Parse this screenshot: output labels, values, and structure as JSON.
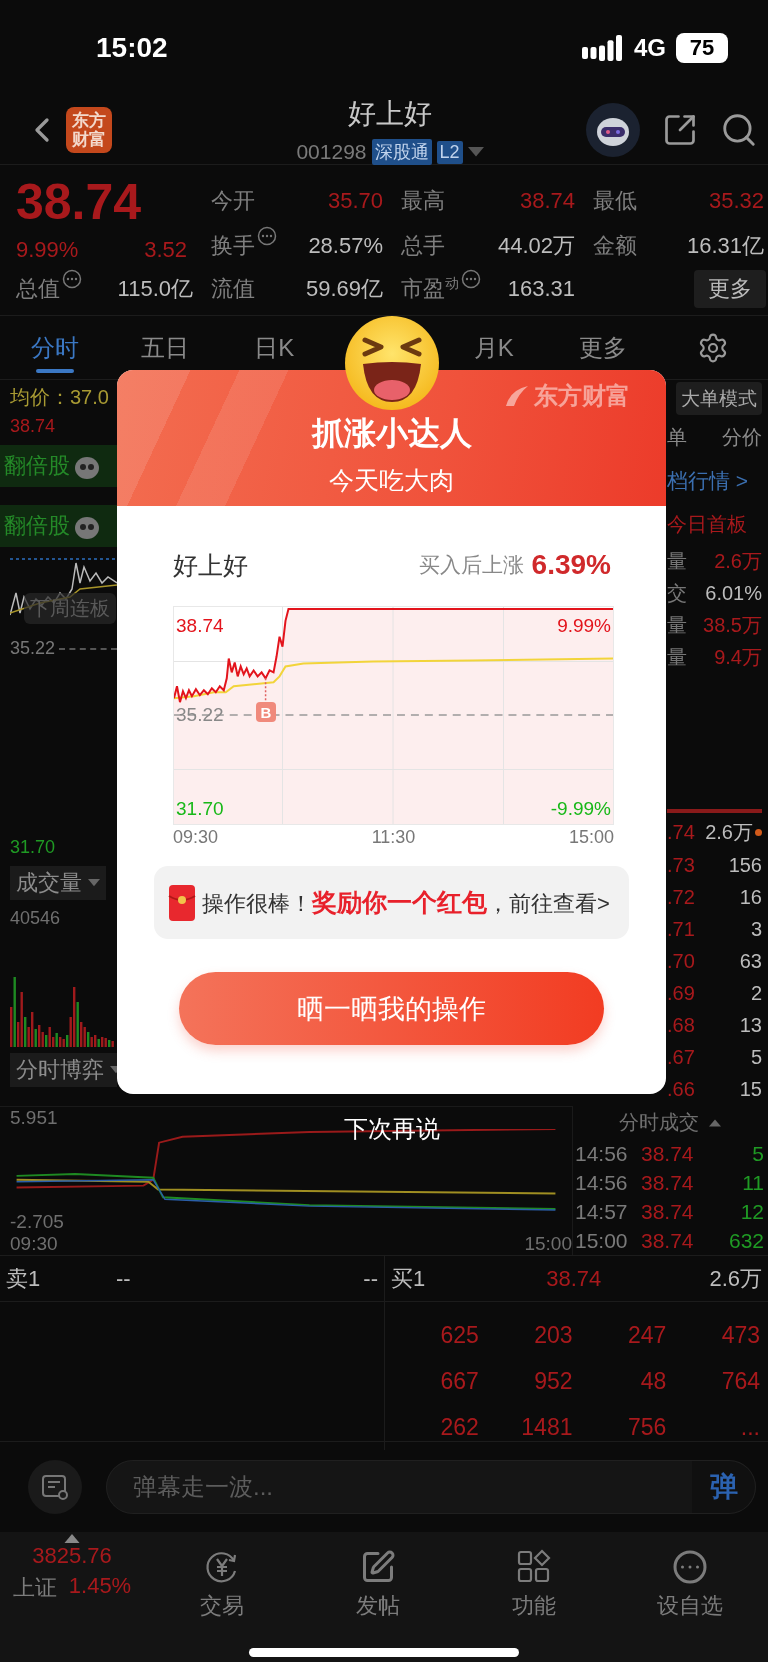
{
  "status_bar": {
    "time": "15:02",
    "network": "4G",
    "battery": "75"
  },
  "header": {
    "logo": [
      "东方",
      "财富"
    ],
    "title": "好上好",
    "code": "001298",
    "tags": [
      "深股通",
      "L2"
    ]
  },
  "quote": {
    "price": "38.74",
    "change_pct": "9.99%",
    "change": "3.52",
    "stats": [
      {
        "label": "今开",
        "value": "35.70",
        "color": "#a8191c",
        "info": false
      },
      {
        "label": "最高",
        "value": "38.74",
        "color": "#a8191c",
        "info": false
      },
      {
        "label": "最低",
        "value": "35.32",
        "color": "#a8191c",
        "info": false
      },
      {
        "label": "换手",
        "value": "28.57%",
        "color": "#bdbdbd",
        "info": true
      },
      {
        "label": "总手",
        "value": "44.02万",
        "color": "#bdbdbd",
        "info": false
      },
      {
        "label": "金额",
        "value": "16.31亿",
        "color": "#bdbdbd",
        "info": false
      },
      {
        "label": "总值",
        "value": "115.0亿",
        "color": "#bdbdbd",
        "info": true
      },
      {
        "label": "流值",
        "value": "59.69亿",
        "color": "#bdbdbd",
        "info": false
      },
      {
        "label": "市盈$^{动}$",
        "value": "163.31",
        "color": "#bdbdbd",
        "info": true
      }
    ],
    "more_button": "更多"
  },
  "tabs": [
    {
      "label": "分时",
      "selected": true
    },
    {
      "label": "五日",
      "selected": false
    },
    {
      "label": "日K",
      "selected": false
    },
    {
      "label": "月K",
      "selected": false
    },
    {
      "label": "更多",
      "selected": false
    }
  ],
  "left_panel": {
    "avg": "均价：37.0",
    "high": "38.74",
    "badges": [
      "翻倍股",
      "翻倍股"
    ],
    "hint": "下周连板",
    "ref": "35.22",
    "low": "31.70",
    "volume_menu": "成交量",
    "volume_max": "40546",
    "game_menu": "分时博弈"
  },
  "right_panel": {
    "mode_button": "大单模式",
    "headers": [
      "单",
      "分价"
    ],
    "level_link": "档行情 >",
    "board_tag": "今日首板",
    "stats": [
      {
        "label": "量",
        "value": "2.6万",
        "color": "#a8191c"
      },
      {
        "label": "交",
        "value": "6.01%",
        "color": "#bdbdbd"
      },
      {
        "label": "量",
        "value": "38.5万",
        "color": "#a8191c"
      },
      {
        "label": "量",
        "value": "9.4万",
        "color": "#a8191c"
      }
    ],
    "book": [
      {
        "price": ".74",
        "volume": "2.6万",
        "dot": true
      },
      {
        "price": ".73",
        "volume": "156",
        "dot": false
      },
      {
        "price": ".72",
        "volume": "16",
        "dot": false
      },
      {
        "price": ".71",
        "volume": "3",
        "dot": false
      },
      {
        "price": ".70",
        "volume": "63",
        "dot": false
      },
      {
        "price": ".69",
        "volume": "2",
        "dot": false
      },
      {
        "price": ".68",
        "volume": "13",
        "dot": false
      },
      {
        "price": ".67",
        "volume": "5",
        "dot": false
      },
      {
        "price": ".66",
        "volume": "15",
        "dot": false
      }
    ]
  },
  "sub_chart": {
    "max": "5.951",
    "min": "-2.705",
    "start": "09:30",
    "end": "15:00"
  },
  "trades": {
    "title": "分时成交",
    "rows": [
      {
        "time": "14:56",
        "price": "38.74",
        "volume": "5"
      },
      {
        "time": "14:56",
        "price": "38.74",
        "volume": "11"
      },
      {
        "time": "14:57",
        "price": "38.74",
        "volume": "12"
      },
      {
        "time": "15:00",
        "price": "38.74",
        "volume": "632"
      }
    ]
  },
  "order_book": {
    "sell": {
      "label": "卖1",
      "price": "--",
      "volume": "--"
    },
    "buy": {
      "label": "买1",
      "price": "38.74",
      "volume": "2.6万"
    },
    "queue": [
      [
        "625",
        "203",
        "247",
        "473"
      ],
      [
        "667",
        "952",
        "48",
        "764"
      ],
      [
        "262",
        "1481",
        "756",
        "..."
      ]
    ]
  },
  "comment_bar": {
    "placeholder": "弹幕走一波...",
    "send": "弹"
  },
  "bottom_nav": {
    "index": {
      "value": "3825.76",
      "name": "上证",
      "change": "1.45%"
    },
    "items": [
      {
        "label": "交易",
        "kind": "trade"
      },
      {
        "label": "发帖",
        "kind": "post"
      },
      {
        "label": "功能",
        "kind": "tools"
      },
      {
        "label": "设自选",
        "kind": "watch"
      }
    ]
  },
  "modal": {
    "brand": "东方财富",
    "title": "抓涨小达人",
    "subtitle": "今天吃大肉",
    "stock": "好上好",
    "gain_label": "买入后上涨",
    "gain": "6.39%",
    "chart": {
      "high": "38.74",
      "high_pct": "9.99%",
      "ref": "35.22",
      "low": "31.70",
      "low_pct": "-9.99%",
      "marker": "B",
      "times": [
        "09:30",
        "11:30",
        "15:00"
      ]
    },
    "reward": {
      "prefix": "操作很棒！",
      "highlight": "奖励你一个红包",
      "suffix": "，前往查看>"
    },
    "share_button": "晒一晒我的操作",
    "dismiss": "下次再说"
  }
}
